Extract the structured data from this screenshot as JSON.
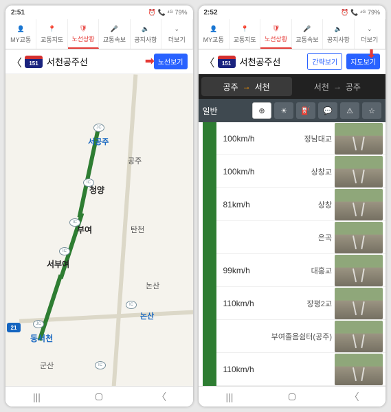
{
  "left": {
    "status": {
      "time": "2:51",
      "battery": "79%",
      "icons": "⏰ 📞 ⁴ᴳ"
    },
    "tabs": [
      "MY교통",
      "교통지도",
      "노선상황",
      "교통속보",
      "공지사항",
      "더보기"
    ],
    "activeTab": 2,
    "route": {
      "shield": "151",
      "name": "서천공주선",
      "btn1": "노선보기"
    },
    "map": {
      "labels": {
        "seogongju": "서공주",
        "gongju": "공주",
        "cheongyang": "청양",
        "buyeo": "부여",
        "tancheon": "탄천",
        "seobuyeo": "서부여",
        "nonsanA": "논산",
        "nonsanB": "논산",
        "dongseocheon": "동서천",
        "gunsan": "군산"
      },
      "ic": "IC",
      "jc": "JC",
      "hw": "21"
    }
  },
  "right": {
    "status": {
      "time": "2:52",
      "battery": "79%",
      "icons": "⏰ 📞 ⁴ᴳ"
    },
    "tabs": [
      "MY교통",
      "교통지도",
      "노선상황",
      "교통속보",
      "공지사항",
      "더보기"
    ],
    "activeTab": 2,
    "route": {
      "shield": "151",
      "name": "서천공주선",
      "btn1": "간략보기",
      "btn2": "지도보기"
    },
    "directions": {
      "a_from": "공주",
      "a_to": "서천",
      "b_from": "서천",
      "b_to": "공주"
    },
    "toolLabel": "일반",
    "rows": [
      {
        "speed": "100km/h",
        "name": "정남대교"
      },
      {
        "speed": "100km/h",
        "name": "상창교"
      },
      {
        "speed": "81km/h",
        "name": "상창"
      },
      {
        "speed": "",
        "name": "은곡"
      },
      {
        "speed": "99km/h",
        "name": "대홍교"
      },
      {
        "speed": "110km/h",
        "name": "장평2교"
      },
      {
        "speed": "",
        "name": "부여졸음쉼터(공주)"
      },
      {
        "speed": "110km/h",
        "name": ""
      }
    ]
  }
}
